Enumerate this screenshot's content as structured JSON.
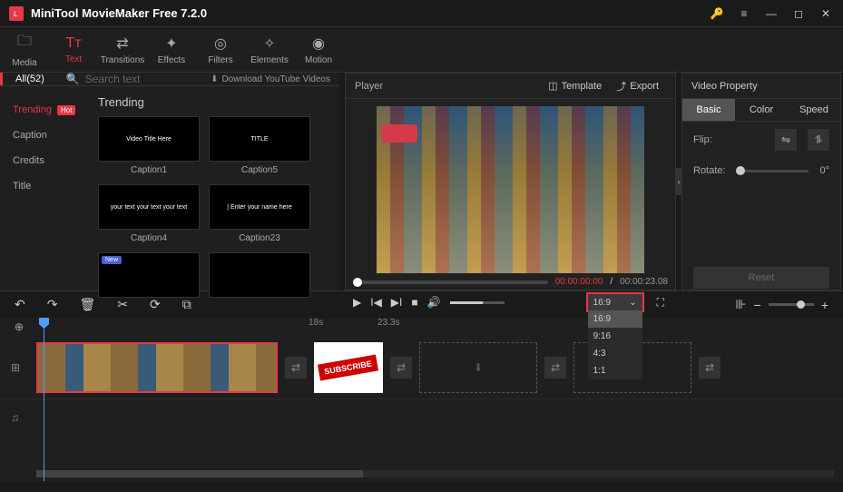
{
  "app": {
    "title": "MiniTool MovieMaker Free 7.2.0"
  },
  "toolbar": [
    {
      "label": "Media",
      "icon": "🗀"
    },
    {
      "label": "Text",
      "icon": "Tᴛ",
      "active": true
    },
    {
      "label": "Transitions",
      "icon": "⇄"
    },
    {
      "label": "Effects",
      "icon": "✦"
    },
    {
      "label": "Filters",
      "icon": "◎"
    },
    {
      "label": "Elements",
      "icon": "✧"
    },
    {
      "label": "Motion",
      "icon": "◉"
    }
  ],
  "filter": {
    "all": "All(52)",
    "search_placeholder": "Search text",
    "download": "Download YouTube Videos"
  },
  "sidebar": {
    "items": [
      {
        "label": "Trending",
        "active": true,
        "hot": true
      },
      {
        "label": "Caption"
      },
      {
        "label": "Credits"
      },
      {
        "label": "Title"
      }
    ],
    "hot_text": "Hot"
  },
  "captions": {
    "title": "Trending",
    "cards": [
      {
        "thumb_text": "Video Title Here",
        "label": "Caption1"
      },
      {
        "thumb_text": "TITLE",
        "label": "Caption5"
      },
      {
        "thumb_text": "your text your text your text",
        "label": "Caption4"
      },
      {
        "thumb_text": "| Enter your name here",
        "label": "Caption23"
      },
      {
        "thumb_text": "",
        "label": "",
        "new": true
      },
      {
        "thumb_text": "",
        "label": ""
      }
    ],
    "new_text": "New"
  },
  "player": {
    "title": "Player",
    "template": "Template",
    "export": "Export",
    "time_current": "00:00:00:00",
    "time_sep": " / ",
    "time_total": "00:00:23.08",
    "aspect_selected": "16:9",
    "aspect_options": [
      "16:9",
      "9:16",
      "4:3",
      "1:1"
    ]
  },
  "props": {
    "title": "Video Property",
    "tabs": [
      "Basic",
      "Color",
      "Speed"
    ],
    "flip_label": "Flip:",
    "rotate_label": "Rotate:",
    "rotate_value": "0°",
    "reset": "Reset"
  },
  "ruler": {
    "m1": "18s",
    "m2": "23.3s"
  },
  "clip2_text": "SUBSCRIBE"
}
